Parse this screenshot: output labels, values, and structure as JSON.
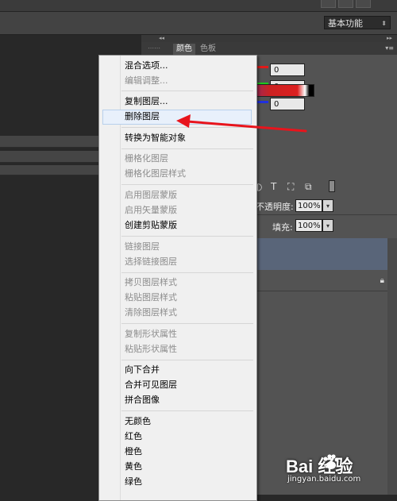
{
  "workspace": {
    "label": "基本功能",
    "dropdown_icon": "up-down-arrows-icon"
  },
  "panels": {
    "collapse_icon": "double-chevron-left-icon",
    "tabs": [
      "颜色",
      "色板"
    ],
    "color_values": {
      "r": "0",
      "g": "0",
      "b": "0"
    },
    "slider_colors": {
      "r": "#e01a1a",
      "g": "#1ec81e",
      "b": "#2030e0"
    },
    "opacity_label": "不透明度:",
    "opacity_value": "100%",
    "fill_label": "填充:",
    "fill_value": "100%",
    "layer_selected_color": "#596579"
  },
  "context_menu": {
    "items": [
      {
        "label": "混合选项...",
        "enabled": true
      },
      {
        "label": "编辑调整...",
        "enabled": false
      },
      {
        "label": "复制图层...",
        "enabled": true
      },
      {
        "label": "删除图层",
        "enabled": true,
        "highlighted": true
      },
      {
        "label": "转换为智能对象",
        "enabled": true
      },
      {
        "label": "栅格化图层",
        "enabled": false
      },
      {
        "label": "栅格化图层样式",
        "enabled": false
      },
      {
        "label": "启用图层蒙版",
        "enabled": false
      },
      {
        "label": "启用矢量蒙版",
        "enabled": false
      },
      {
        "label": "创建剪贴蒙版",
        "enabled": true
      },
      {
        "label": "链接图层",
        "enabled": false
      },
      {
        "label": "选择链接图层",
        "enabled": false
      },
      {
        "label": "拷贝图层样式",
        "enabled": false
      },
      {
        "label": "粘贴图层样式",
        "enabled": false
      },
      {
        "label": "清除图层样式",
        "enabled": false
      },
      {
        "label": "复制形状属性",
        "enabled": false
      },
      {
        "label": "粘贴形状属性",
        "enabled": false
      },
      {
        "label": "向下合并",
        "enabled": true
      },
      {
        "label": "合并可见图层",
        "enabled": true
      },
      {
        "label": "拼合图像",
        "enabled": true
      },
      {
        "label": "无颜色",
        "enabled": true
      },
      {
        "label": "红色",
        "enabled": true
      },
      {
        "label": "橙色",
        "enabled": true
      },
      {
        "label": "黄色",
        "enabled": true
      },
      {
        "label": "绿色",
        "enabled": true
      }
    ]
  },
  "annotation_arrow_color": "#e8141c",
  "watermark": {
    "logo": "Bai  经验",
    "url": "jingyan.baidu.com"
  }
}
